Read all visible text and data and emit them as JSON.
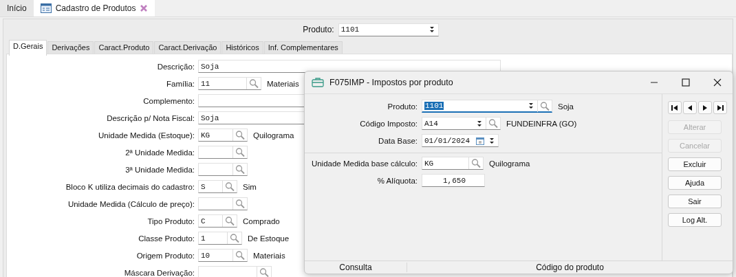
{
  "top_tabs": [
    {
      "label": "Início",
      "selected": false,
      "icon": false,
      "closable": false
    },
    {
      "label": "Cadastro de Produtos",
      "selected": true,
      "icon": true,
      "closable": true
    }
  ],
  "product": {
    "label": "Produto:",
    "value": "1101"
  },
  "tabs": [
    {
      "label": "D.Gerais",
      "selected": true
    },
    {
      "label": "Derivações",
      "selected": false
    },
    {
      "label": "Caract.Produto",
      "selected": false
    },
    {
      "label": "Caract.Derivação",
      "selected": false
    },
    {
      "label": "Históricos",
      "selected": false
    },
    {
      "label": "Inf. Complementares",
      "selected": false
    }
  ],
  "fields": [
    {
      "label": "Descrição:",
      "kind": "text",
      "value": "Soja"
    },
    {
      "label": "Família:",
      "kind": "lookup",
      "value": "11",
      "description": "Materiais"
    },
    {
      "label": "Complemento:",
      "kind": "text"
    },
    {
      "label": "Descrição p/ Nota Fiscal:",
      "kind": "text",
      "value": "Soja"
    },
    {
      "label": "Unidade Medida (Estoque):",
      "kind": "lookup",
      "value": "KG",
      "description": "Quilograma"
    },
    {
      "label": "2ª Unidade Medida:",
      "kind": "lookup"
    },
    {
      "label": "3ª Unidade Medida:",
      "kind": "lookup"
    },
    {
      "label": "Bloco K utiliza decimais do cadastro:",
      "kind": "lookup",
      "value": "S",
      "description": "Sim"
    },
    {
      "label": "Unidade Medida (Cálculo de preço):",
      "kind": "lookup"
    },
    {
      "label": "Tipo Produto:",
      "kind": "lookup",
      "value": "C",
      "description": "Comprado"
    },
    {
      "label": "Classe Produto:",
      "kind": "lookup",
      "value": "1",
      "description": "De Estoque"
    },
    {
      "label": "Origem Produto:",
      "kind": "lookup",
      "value": "10",
      "description": "Materiais"
    },
    {
      "label": "Máscara Derivação:",
      "kind": "lookup"
    }
  ],
  "dialog": {
    "title": "F075IMP - Impostos por produto",
    "fields": [
      {
        "label": "Produto:",
        "kind": "combo",
        "value": "1101",
        "selected": true,
        "description": "Soja"
      },
      {
        "label": "Código Imposto:",
        "kind": "combo",
        "value": "A14",
        "selected": false,
        "description": "FUNDEINFRA (GO)"
      },
      {
        "label": "Data Base:",
        "kind": "date",
        "value": "01/01/2024",
        "selected": false
      },
      {
        "label": "Unidade Medida base cálculo:",
        "kind": "lookup",
        "value": "KG",
        "selected": false,
        "description": "Quilograma"
      },
      {
        "label": "% Alíquota:",
        "kind": "number",
        "value": "1,650",
        "selected": false
      }
    ],
    "buttons": [
      {
        "label": "Alterar",
        "disabled": true
      },
      {
        "label": "Cancelar",
        "disabled": true
      },
      {
        "label": "Excluir",
        "disabled": false
      },
      {
        "label": "Ajuda",
        "disabled": false
      },
      {
        "label": "Sair",
        "disabled": false
      },
      {
        "label": "Log Alt.",
        "disabled": false
      }
    ],
    "status_bar": [
      "Consulta",
      "Código do produto"
    ]
  }
}
